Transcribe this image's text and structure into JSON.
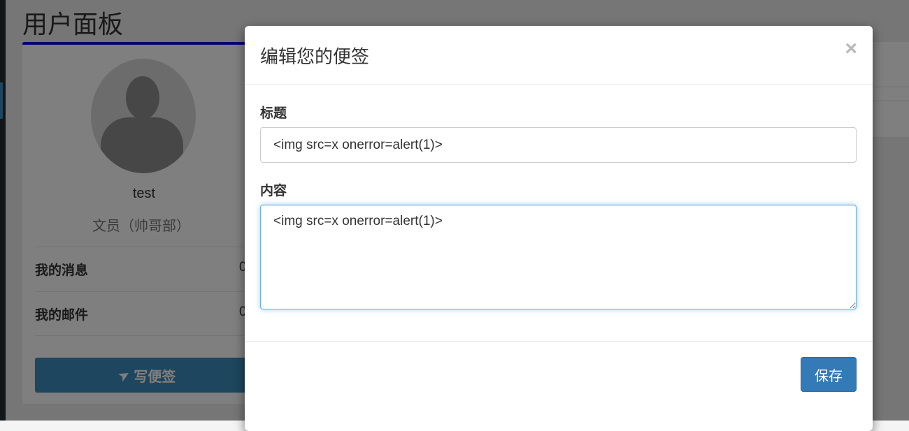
{
  "page": {
    "title": "用户面板"
  },
  "profile": {
    "username": "test",
    "role": "文员（帅哥部）",
    "stats": [
      {
        "label": "我的消息",
        "value": "0"
      },
      {
        "label": "我的邮件",
        "value": "0"
      }
    ],
    "write_note_label": "写便签",
    "write_note_icon": "pushpin-icon"
  },
  "modal": {
    "title": "编辑您的便签",
    "close_label": "×",
    "title_field_label": "标题",
    "title_field_value": "<img src=x onerror=alert(1)>",
    "content_field_label": "内容",
    "content_field_value": "<img src=x onerror=alert(1)>",
    "save_label": "保存"
  },
  "colors": {
    "accent": "#3c8dbc",
    "primary_button": "#337ab7",
    "focus_border": "#66afe9",
    "box_top_border": "#0000ee"
  }
}
